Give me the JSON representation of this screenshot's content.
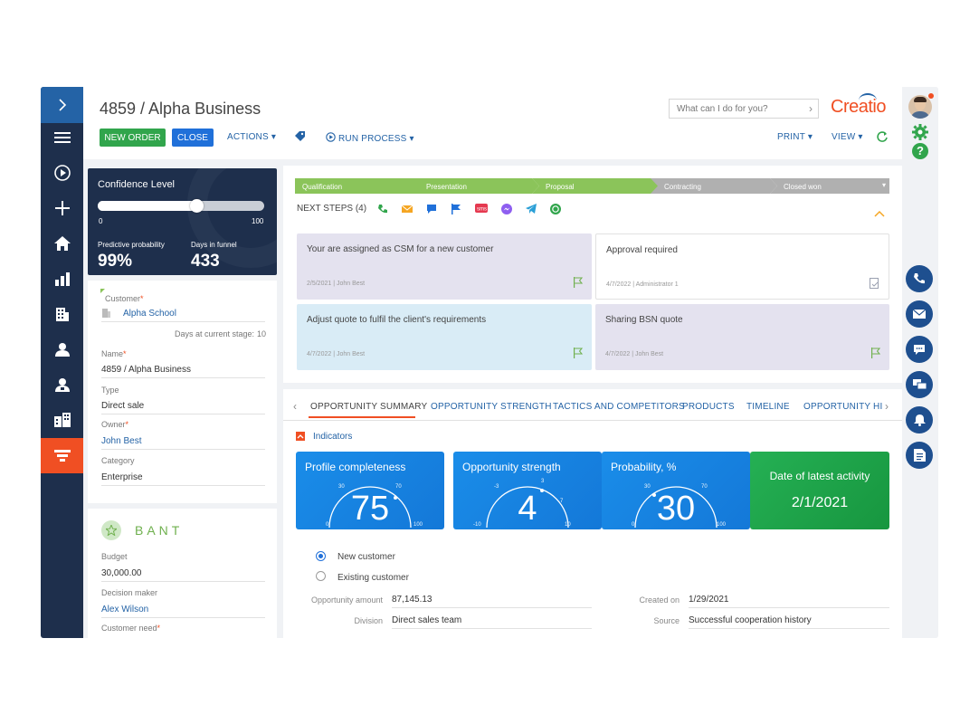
{
  "header": {
    "title": "4859 / Alpha Business",
    "search_placeholder": "What can I do for you?",
    "logo": "Creatio",
    "new_order": "NEW ORDER",
    "close": "CLOSE",
    "actions": "ACTIONS",
    "run_process": "RUN PROCESS",
    "print": "PRINT",
    "view": "VIEW"
  },
  "confidence": {
    "title": "Confidence Level",
    "slider_min": "0",
    "slider_max": "100",
    "slider_value_pct": 59,
    "predictive_label": "Predictive probability",
    "predictive_value": "99%",
    "days_label": "Days in funnel",
    "days_value": "433"
  },
  "details": {
    "customer_label": "Customer",
    "customer_value": "Alpha School",
    "days_stage_label": "Days at current stage:",
    "days_stage_value": "10",
    "name_label": "Name",
    "name_value": "4859 / Alpha Business",
    "type_label": "Type",
    "type_value": "Direct sale",
    "owner_label": "Owner",
    "owner_value": "John Best",
    "category_label": "Category",
    "category_value": "Enterprise"
  },
  "bant": {
    "title": "BANT",
    "budget_label": "Budget",
    "budget_value": "30,000.00",
    "decision_label": "Decision maker",
    "decision_value": "Alex Wilson",
    "need_label": "Customer need"
  },
  "stages": [
    "Qualification",
    "Presentation",
    "Proposal",
    "Contracting",
    "Closed won"
  ],
  "next_steps": {
    "label": "NEXT STEPS (4)",
    "cards": [
      {
        "text": "Your are assigned as CSM for a new customer",
        "date": "2/5/2021",
        "user": "John Best"
      },
      {
        "text": "Approval required",
        "date": "4/7/2022",
        "user": "Administrator 1"
      },
      {
        "text": "Adjust quote to fulfil the client's requirements",
        "date": "4/7/2022",
        "user": "John Best"
      },
      {
        "text": "Sharing BSN quote",
        "date": "4/7/2022",
        "user": "John Best"
      }
    ]
  },
  "tabs": [
    "OPPORTUNITY SUMMARY",
    "OPPORTUNITY STRENGTH",
    "TACTICS AND COMPETITORS",
    "PRODUCTS",
    "TIMELINE",
    "OPPORTUNITY HISTO"
  ],
  "indicators": {
    "label": "Indicators",
    "tiles": [
      {
        "title": "Profile completeness",
        "value": "75",
        "ticks": [
          "0",
          "30",
          "70",
          "100"
        ]
      },
      {
        "title": "Opportunity strength",
        "value": "4",
        "ticks": [
          "-10",
          "-3",
          "3",
          "7",
          "10"
        ]
      },
      {
        "title": "Probability, %",
        "value": "30",
        "ticks": [
          "0",
          "30",
          "70",
          "100"
        ]
      },
      {
        "title": "Date of latest activity",
        "value": "2/1/2021"
      }
    ]
  },
  "summary": {
    "new_customer": "New customer",
    "existing_customer": "Existing customer",
    "amount_label": "Opportunity amount",
    "amount_value": "87,145.13",
    "division_label": "Division",
    "division_value": "Direct sales team",
    "created_label": "Created on",
    "created_value": "1/29/2021",
    "source_label": "Source",
    "source_value": "Successful cooperation history"
  },
  "colors": {
    "nav": "#1e2f4c",
    "accent": "#f04f23",
    "stage_done": "#8bc45a",
    "stage_todo": "#b0b0b0",
    "tile_blue": "#1e88e5",
    "tile_green": "#1ea24a"
  }
}
